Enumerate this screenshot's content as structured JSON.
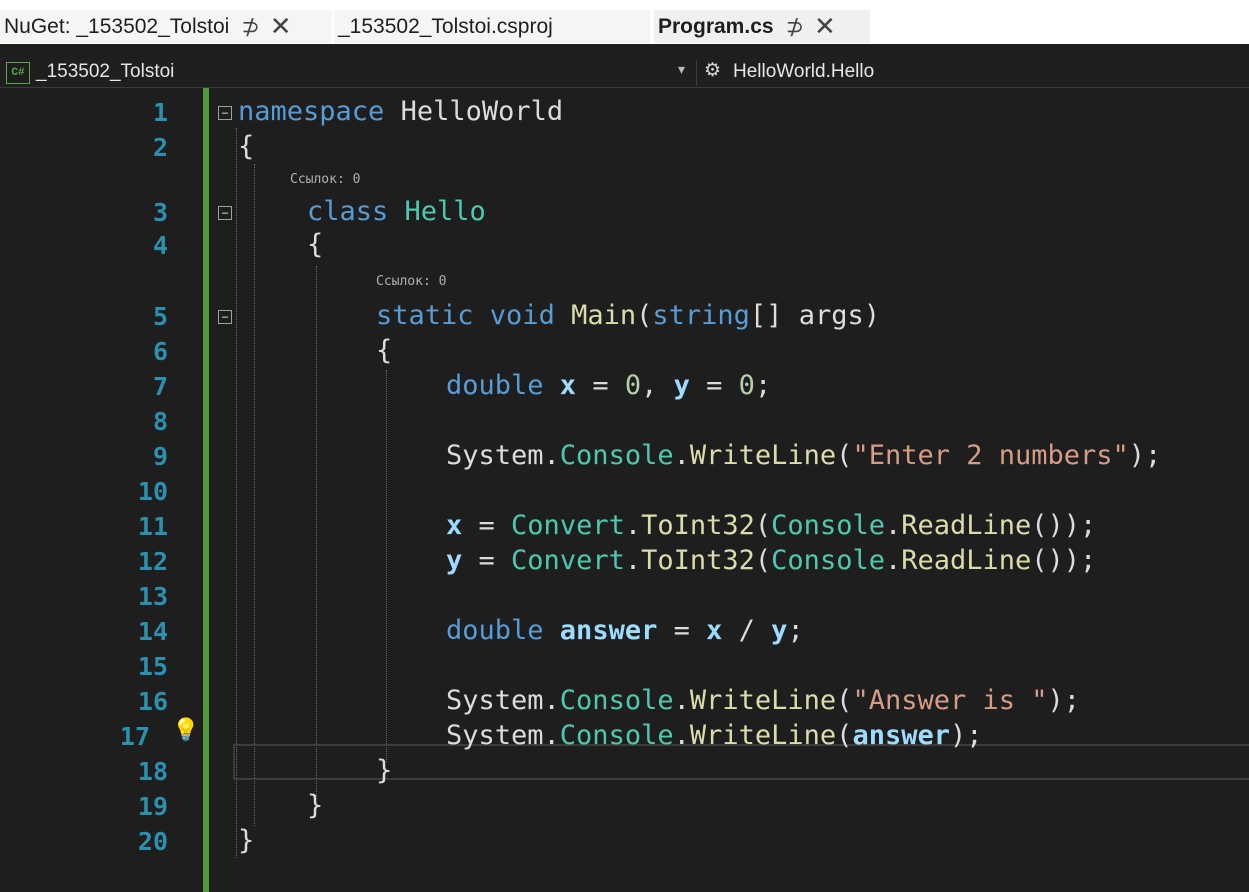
{
  "tabs": [
    {
      "label": "NuGet: _153502_Tolstoi",
      "pin": "⊅",
      "close": "✕"
    },
    {
      "label": "_153502_Tolstoi.csproj"
    },
    {
      "label": "Program.cs",
      "pin": "⊅",
      "close": "✕",
      "active": true
    }
  ],
  "navbar": {
    "badge": "C#",
    "project": "_153502_Tolstoi",
    "type_member": "HelloWorld.Hello"
  },
  "editor": {
    "line_numbers": [
      "1",
      "2",
      "3",
      "4",
      "5",
      "6",
      "7",
      "8",
      "9",
      "10",
      "11",
      "12",
      "13",
      "14",
      "15",
      "16",
      "17",
      "18",
      "19",
      "20"
    ],
    "references_label_1": "Ссылок: 0",
    "references_label_2": "Ссылок: 0",
    "lines": {
      "l1_kw": "namespace",
      "l1_name": " HelloWorld",
      "l2": "{",
      "l3_kw": "class",
      "l3_name": " Hello",
      "l4": "{",
      "l5_static": "static",
      "l5_void": " void",
      "l5_main": " Main",
      "l5_paren": "(",
      "l5_string": "string",
      "l5_rest": "[] args)",
      "l6": "{",
      "l7_kw": "double",
      "l7_x": " x",
      "l7_mid": " = ",
      "l7_n1": "0",
      "l7_comma": ", ",
      "l7_y": "y",
      "l7_eq": " = ",
      "l7_n2": "0",
      "l7_semi": ";",
      "l9_sys": "System.",
      "l9_console": "Console",
      "l9_dot": ".",
      "l9_fn": "WriteLine",
      "l9_open": "(",
      "l9_str": "\"Enter 2 numbers\"",
      "l9_close": ");",
      "l11_x": "x",
      "l11_eq": " = ",
      "l11_conv": "Convert",
      "l11_dot": ".",
      "l11_fn": "ToInt32",
      "l11_open": "(",
      "l11_console": "Console",
      "l11_dot2": ".",
      "l11_fn2": "ReadLine",
      "l11_close": "());",
      "l12_y": "y",
      "l12_eq": " = ",
      "l12_conv": "Convert",
      "l12_dot": ".",
      "l12_fn": "ToInt32",
      "l12_open": "(",
      "l12_console": "Console",
      "l12_dot2": ".",
      "l12_fn2": "ReadLine",
      "l12_close": "());",
      "l14_kw": "double",
      "l14_answer": " answer",
      "l14_mid": " = ",
      "l14_x": "x",
      "l14_div": " / ",
      "l14_y": "y",
      "l14_semi": ";",
      "l16_sys": "System.",
      "l16_console": "Console",
      "l16_dot": ".",
      "l16_fn": "WriteLine",
      "l16_open": "(",
      "l16_str": "\"Answer is \"",
      "l16_close": ");",
      "l17_sys": "System.",
      "l17_console": "Console",
      "l17_dot": ".",
      "l17_fn": "WriteLine",
      "l17_open": "(",
      "l17_answer": "answer",
      "l17_close": ");",
      "l18": "}",
      "l19": "}",
      "l20": "}"
    }
  },
  "icons": {
    "lightbulb": "lightbulb-icon",
    "fold": "minus-box-icon"
  },
  "colors": {
    "keyword": "#569cd6",
    "type": "#4ec9b0",
    "method": "#dcdcaa",
    "number": "#b5cea8",
    "string": "#d69d85",
    "variable": "#9cdcfe",
    "line_number": "#2b91af",
    "change_bar": "#4e9a3c"
  }
}
